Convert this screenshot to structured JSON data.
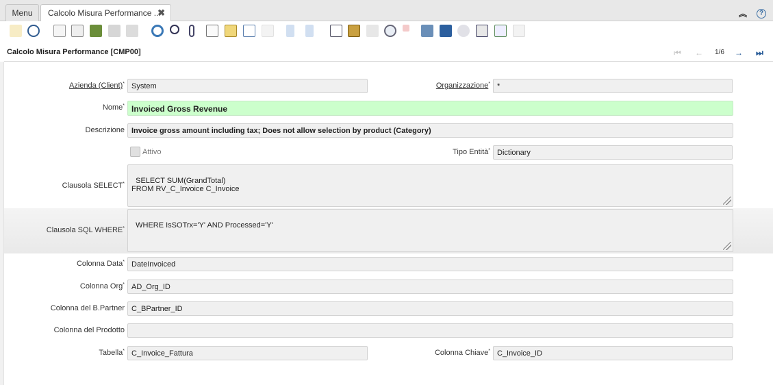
{
  "tabs": {
    "menu_label": "Menu",
    "active_label": "Calcolo Misura Performance ...",
    "close_glyph": "✖"
  },
  "window": {
    "title": "Calcolo Misura Performance [CMP00]",
    "record_counter": "1/6"
  },
  "toolbar": {
    "icons": [
      "undo-icon",
      "help-icon",
      "new-record-icon",
      "copy-record-icon",
      "delete-icon",
      "save-icon",
      "save-new-icon",
      "refresh-icon",
      "find-icon",
      "attachment-icon",
      "chat-icon",
      "archive-icon",
      "grid-toggle-icon",
      "detail-icon",
      "parent-record-icon",
      "detail-record-icon",
      "report-icon",
      "archived-docs-icon",
      "print-icon",
      "zoom-across-icon",
      "request-icon",
      "workflow-icon",
      "product-info-icon",
      "settings-icon",
      "export-icon",
      "import-icon",
      "quick-form-icon"
    ]
  },
  "form": {
    "client_label": "Azienda (Client)",
    "client_value": "System",
    "org_label": "Organizzazione",
    "org_value": "*",
    "name_label": "Nome",
    "name_value": "Invoiced Gross Revenue",
    "description_label": "Descrizione",
    "description_value": "Invoice gross amount including tax; Does not allow selection by product (Category)",
    "active_label": "Attivo",
    "entity_type_label": "Tipo Entità",
    "entity_type_value": "Dictionary",
    "select_label": "Clausola SELECT",
    "select_value": "SELECT SUM(GrandTotal)\nFROM RV_C_Invoice C_Invoice",
    "where_label": "Clausola SQL WHERE",
    "where_value": "WHERE IsSOTrx='Y' AND Processed='Y'",
    "date_column_label": "Colonna Data",
    "date_column_value": "DateInvoiced",
    "org_column_label": "Colonna Org",
    "org_column_value": "AD_Org_ID",
    "bpartner_column_label": "Colonna del B.Partner",
    "bpartner_column_value": "C_BPartner_ID",
    "product_column_label": "Colonna del Prodotto",
    "product_column_value": "",
    "table_label": "Tabella",
    "table_value": "C_Invoice_Fattura",
    "key_column_label": "Colonna Chiave",
    "key_column_value": "C_Invoice_ID"
  }
}
